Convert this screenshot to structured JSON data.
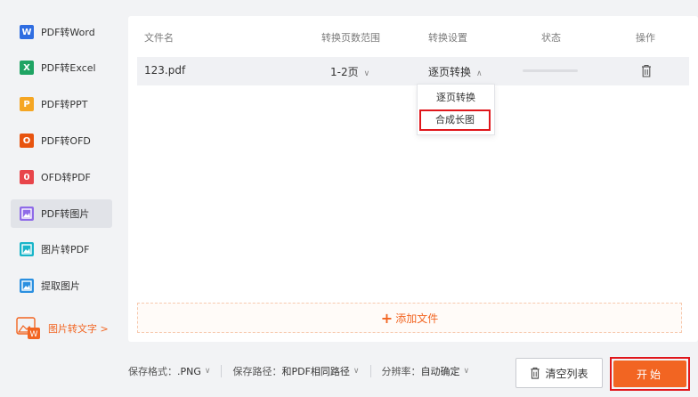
{
  "sidebar": {
    "items": [
      {
        "label": "PDF转Word",
        "icon": "word-icon",
        "icon_text": "W",
        "color": "#2f6de1"
      },
      {
        "label": "PDF转Excel",
        "icon": "excel-icon",
        "icon_text": "X",
        "color": "#1fa463"
      },
      {
        "label": "PDF转PPT",
        "icon": "ppt-icon",
        "icon_text": "P",
        "color": "#f5a623"
      },
      {
        "label": "PDF转OFD",
        "icon": "ofd-icon",
        "icon_text": "O",
        "color": "#e8540f"
      },
      {
        "label": "OFD转PDF",
        "icon": "ofd-to-pdf-icon",
        "icon_text": "0",
        "color": "#e8454a"
      },
      {
        "label": "PDF转图片",
        "icon": "image-icon",
        "icon_text": "",
        "color": "#8f6be8",
        "active": true
      },
      {
        "label": "图片转PDF",
        "icon": "image-to-pdf-icon",
        "icon_text": "",
        "color": "#19b5c9"
      },
      {
        "label": "提取图片",
        "icon": "extract-image-icon",
        "icon_text": "",
        "color": "#2a8fe0"
      }
    ],
    "image_to_text": {
      "label": "图片转文字 >",
      "icon": "image-to-text-icon",
      "color": "#f26522"
    }
  },
  "table": {
    "headers": [
      "文件名",
      "转换页数范围",
      "转换设置",
      "状态",
      "操作"
    ],
    "rows": [
      {
        "filename": "123.pdf",
        "page_range": "1-2页",
        "setting": "逐页转换",
        "status": "",
        "action_icon": "trash-icon"
      }
    ]
  },
  "dropdown": {
    "options": [
      "逐页转换",
      "合成长图"
    ],
    "highlighted": "合成长图"
  },
  "add_file": {
    "label": "添加文件"
  },
  "bottom": {
    "format_label": "保存格式：",
    "format_value": ".PNG",
    "path_label": "保存路径：",
    "path_value": "和PDF相同路径",
    "resolution_label": "分辨率：",
    "resolution_value": "自动确定",
    "clear_label": "清空列表",
    "start_label": "开始"
  },
  "colors": {
    "accent": "#f26522",
    "highlight": "#e0161b"
  }
}
